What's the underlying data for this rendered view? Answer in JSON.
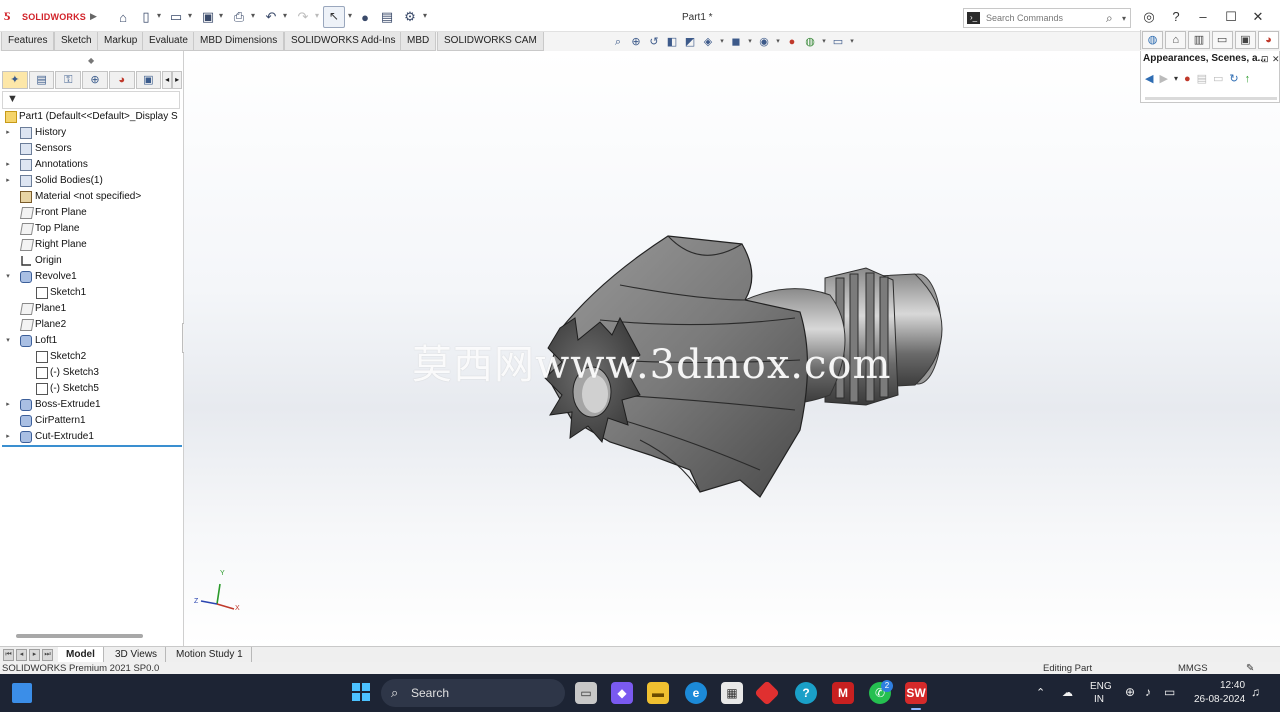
{
  "window": {
    "brand": "SOLIDWORKS",
    "doc_title": "Part1 *",
    "search_placeholder": "Search Commands"
  },
  "command_tabs": [
    "Features",
    "Sketch",
    "Markup",
    "Evaluate",
    "MBD Dimensions",
    "SOLIDWORKS Add-Ins",
    "MBD",
    "SOLIDWORKS CAM"
  ],
  "tree": [
    {
      "label": "Part1  (Default<<Default>_Display S",
      "icon": "part-icon"
    },
    {
      "label": "History",
      "icon": "history-icon"
    },
    {
      "label": "Sensors",
      "icon": "sensors-icon"
    },
    {
      "label": "Annotations",
      "icon": "annotations-icon"
    },
    {
      "label": "Solid Bodies(1)",
      "icon": "solid-bodies-icon"
    },
    {
      "label": "Material <not specified>",
      "icon": "material-icon"
    },
    {
      "label": "Front Plane",
      "icon": "plane-icon"
    },
    {
      "label": "Top Plane",
      "icon": "plane-icon"
    },
    {
      "label": "Right Plane",
      "icon": "plane-icon"
    },
    {
      "label": "Origin",
      "icon": "origin-icon"
    },
    {
      "label": "Revolve1",
      "icon": "revolve-icon"
    },
    {
      "label": "Sketch1",
      "icon": "sketch-icon"
    },
    {
      "label": "Plane1",
      "icon": "plane-icon"
    },
    {
      "label": "Plane2",
      "icon": "plane-icon"
    },
    {
      "label": "Loft1",
      "icon": "loft-icon"
    },
    {
      "label": "Sketch2",
      "icon": "sketch-icon"
    },
    {
      "label": "(-) Sketch3",
      "icon": "sketch-icon"
    },
    {
      "label": "(-) Sketch5",
      "icon": "sketch-icon"
    },
    {
      "label": "Boss-Extrude1",
      "icon": "extrude-icon"
    },
    {
      "label": "CirPattern1",
      "icon": "pattern-icon"
    },
    {
      "label": "Cut-Extrude1",
      "icon": "cut-extrude-icon"
    }
  ],
  "viewport": {
    "watermark": "莫西网www.3dmox.com",
    "triad": {
      "y": "Y",
      "x": "X",
      "z": "Z"
    }
  },
  "task_pane": {
    "title": "Appearances, Scenes, a..."
  },
  "bottom_tabs": [
    "Model",
    "3D Views",
    "Motion Study 1"
  ],
  "status": {
    "product": "SOLIDWORKS Premium 2021 SP0.0",
    "mode": "Editing Part",
    "units": "MMGS"
  },
  "taskbar": {
    "search_label": "Search",
    "lang_top": "ENG",
    "lang_bottom": "IN",
    "time": "12:40",
    "date": "26-08-2024",
    "whatsapp_badge": "2"
  }
}
